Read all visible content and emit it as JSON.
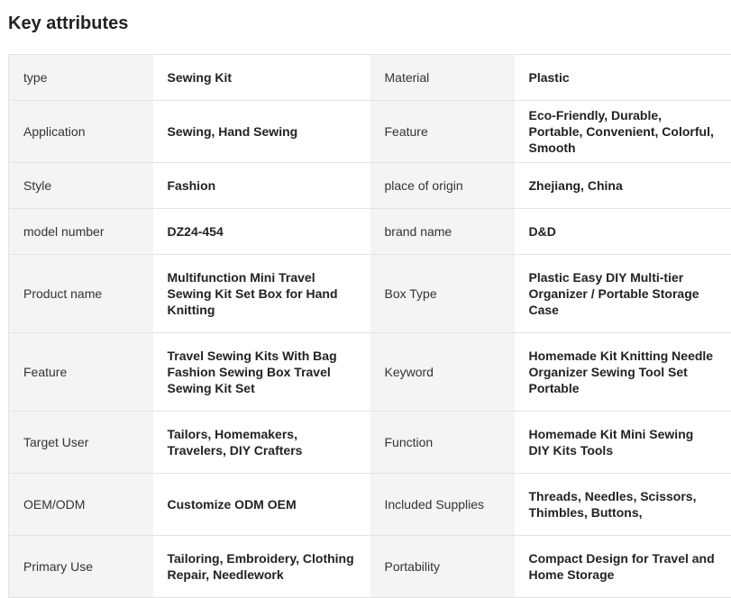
{
  "section_title": "Key attributes",
  "rows": [
    {
      "l1": "type",
      "v1": "Sewing Kit",
      "l2": "Material",
      "v2": "Plastic"
    },
    {
      "l1": "Application",
      "v1": "Sewing, Hand Sewing",
      "l2": "Feature",
      "v2": "Eco-Friendly, Durable, Portable, Convenient, Colorful, Smooth"
    },
    {
      "l1": "Style",
      "v1": "Fashion",
      "l2": "place of origin",
      "v2": "Zhejiang, China"
    },
    {
      "l1": "model number",
      "v1": "DZ24-454",
      "l2": "brand name",
      "v2": "D&D"
    },
    {
      "l1": "Product name",
      "v1": "Multifunction Mini Travel Sewing Kit Set Box for Hand Knitting",
      "l2": "Box Type",
      "v2": "Plastic Easy DIY Multi-tier Organizer / Portable Storage Case"
    },
    {
      "l1": "Feature",
      "v1": "Travel Sewing Kits With Bag Fashion Sewing Box Travel Sewing Kit Set",
      "l2": "Keyword",
      "v2": "Homemade Kit Knitting Needle Organizer Sewing Tool Set Portable"
    },
    {
      "l1": "Target User",
      "v1": "Tailors, Homemakers, Travelers, DIY Crafters",
      "l2": "Function",
      "v2": "Homemade Kit Mini Sewing DIY Kits Tools"
    },
    {
      "l1": "OEM/ODM",
      "v1": "Customize ODM OEM",
      "l2": "Included Supplies",
      "v2": "Threads, Needles, Scissors, Thimbles, Buttons,"
    },
    {
      "l1": "Primary Use",
      "v1": "Tailoring, Embroidery, Clothing Repair, Needlework",
      "l2": "Portability",
      "v2": "Compact Design for Travel and Home Storage"
    }
  ]
}
